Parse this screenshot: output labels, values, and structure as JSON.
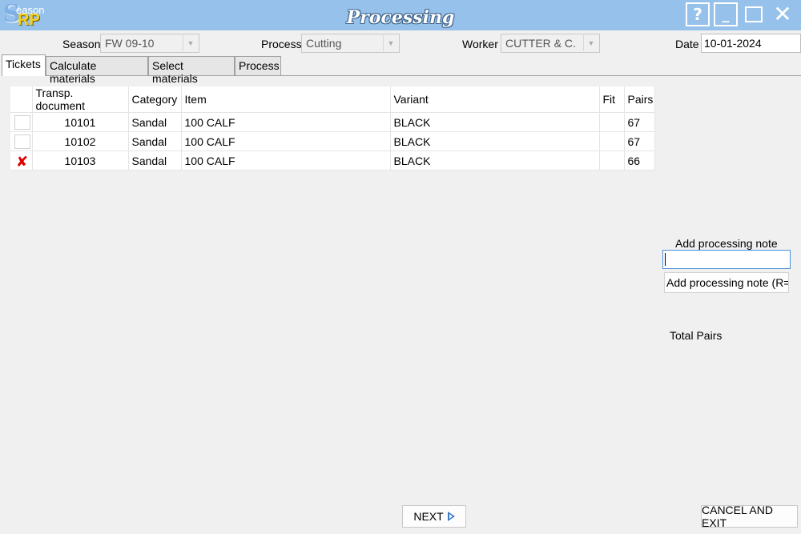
{
  "app": {
    "title": "Processing",
    "logo_s": "S",
    "logo_season": "eason",
    "logo_rp": "RP",
    "window_buttons": {
      "help": "?",
      "minimize": "_",
      "close": "✕"
    }
  },
  "fields": {
    "season_label": "Season",
    "season_value": "FW 09-10",
    "process_label": "Process",
    "process_value": "Cutting",
    "worker_label": "Worker",
    "worker_value": "CUTTER & C.",
    "date_label": "Date",
    "date_value": "10-01-2024"
  },
  "tabs": [
    {
      "label": "Tickets",
      "active": true
    },
    {
      "label": "Calculate materials",
      "active": false
    },
    {
      "label": "Select materials",
      "active": false
    },
    {
      "label": "Process",
      "active": false
    }
  ],
  "grid": {
    "columns": [
      "",
      "Transp. document",
      "Category",
      "Item",
      "Variant",
      "Fit",
      "Pairs"
    ],
    "rows": [
      {
        "checked": false,
        "transp_document": "10101",
        "category": "Sandal",
        "item": "100 CALF",
        "variant": "BLACK",
        "fit": "",
        "pairs": "67"
      },
      {
        "checked": false,
        "transp_document": "10102",
        "category": "Sandal",
        "item": "100 CALF",
        "variant": "BLACK",
        "fit": "",
        "pairs": "67"
      },
      {
        "checked": true,
        "transp_document": "10103",
        "category": "Sandal",
        "item": "100 CALF",
        "variant": "BLACK",
        "fit": "",
        "pairs": "66"
      }
    ]
  },
  "side": {
    "note_label": "Add processing note",
    "note_value": "",
    "note_button": "Add processing note (R=",
    "total_label": "Total Pairs"
  },
  "buttons": {
    "next": "NEXT",
    "cancel": "CANCEL AND EXIT"
  },
  "icons": {
    "check_mark": "✘"
  },
  "colors": {
    "titlebar": "#96c1eb",
    "accent": "#3a78c9",
    "check": "#e00000"
  }
}
